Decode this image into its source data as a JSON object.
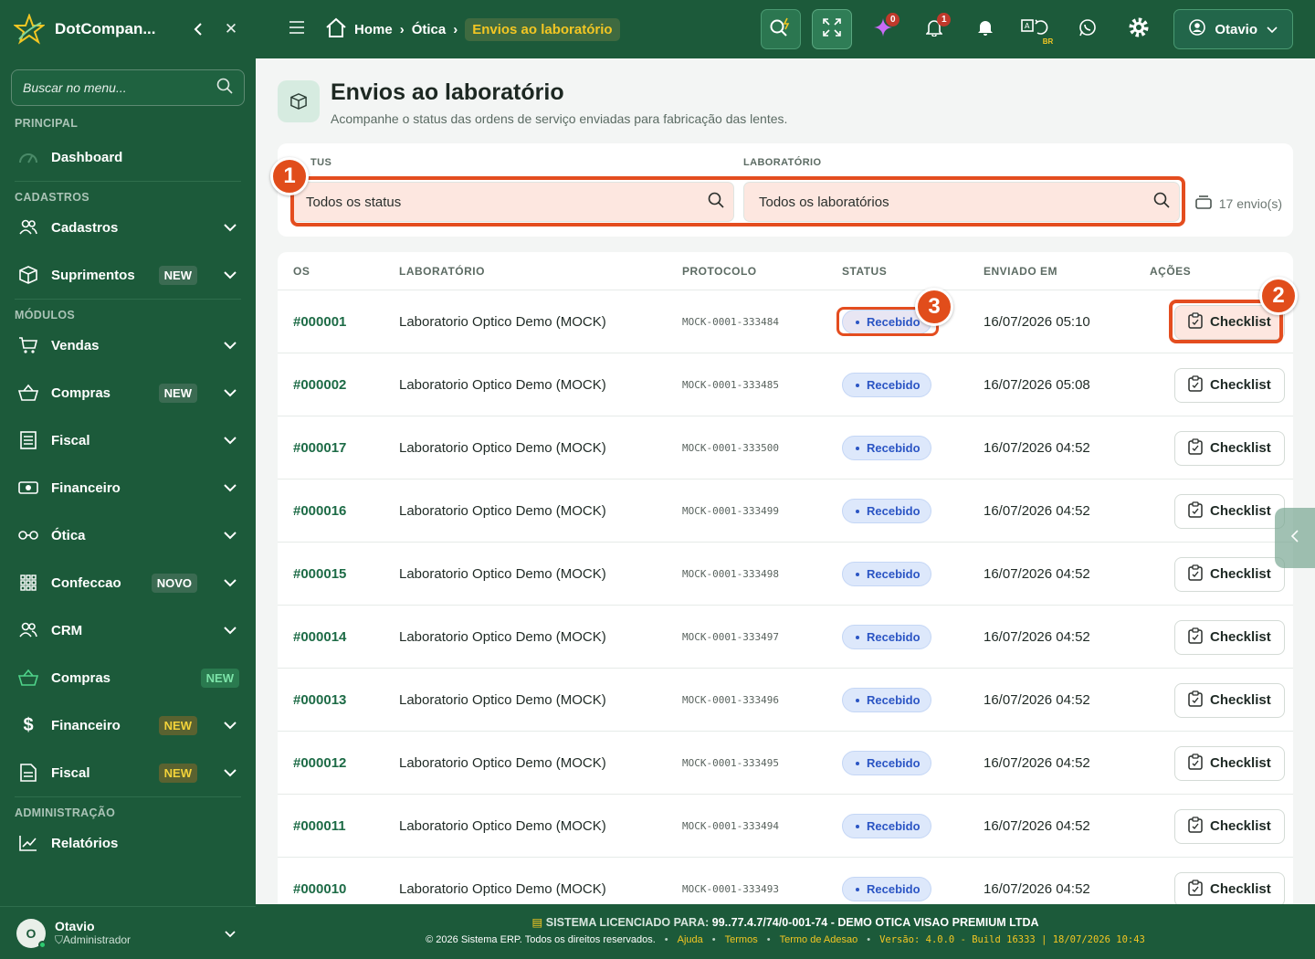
{
  "brand": {
    "name": "DotCompan..."
  },
  "sidebar": {
    "search_placeholder": "Buscar no menu...",
    "sections": {
      "principal": "PRINCIPAL",
      "cadastros": "CADASTROS",
      "modulos": "MÓDULOS",
      "administracao": "ADMINISTRAÇÃO"
    },
    "items": {
      "dashboard": "Dashboard",
      "cadastros": "Cadastros",
      "suprimentos": "Suprimentos",
      "vendas": "Vendas",
      "compras": "Compras",
      "fiscal": "Fiscal",
      "financeiro": "Financeiro",
      "otica": "Ótica",
      "confeccao": "Confeccao",
      "crm": "CRM",
      "compras2": "Compras",
      "financeiro2": "Financeiro",
      "fiscal2": "Fiscal",
      "relatorios": "Relatórios"
    },
    "badges": {
      "suprimentos": "NEW",
      "compras": "NEW",
      "confeccao": "NOVO",
      "compras2": "NEW",
      "financeiro2": "NEW",
      "fiscal2": "NEW"
    },
    "user": {
      "initial": "O",
      "name": "Otavio",
      "role": "Administrador"
    }
  },
  "topbar": {
    "breadcrumb": {
      "home": "Home",
      "otica": "Ótica",
      "current": "Envios ao laboratório"
    },
    "notif_sparkle": "0",
    "notif_bell": "1",
    "lang_label": "BR",
    "user": "Otavio"
  },
  "page": {
    "title": "Envios ao laboratório",
    "subtitle": "Acompanhe o status das ordens de serviço enviadas para fabricação das lentes."
  },
  "filters": {
    "status_label": "TUS",
    "status_value": "Todos os status",
    "lab_label": "LABORATÓRIO",
    "lab_value": "Todos os laboratórios",
    "count": "17 envio(s)"
  },
  "markers": {
    "m1": "1",
    "m2": "2",
    "m3": "3"
  },
  "table": {
    "headers": {
      "os": "OS",
      "lab": "LABORATÓRIO",
      "proto": "PROTOCOLO",
      "status": "STATUS",
      "sent": "ENVIADO EM",
      "actions": "AÇÕES"
    },
    "action_label": "Checklist",
    "rows": [
      {
        "os": "#000001",
        "lab": "Laboratorio Optico Demo (MOCK)",
        "proto": "MOCK-0001-333484",
        "status": "Recebido",
        "sent": "16/07/2026 05:10"
      },
      {
        "os": "#000002",
        "lab": "Laboratorio Optico Demo (MOCK)",
        "proto": "MOCK-0001-333485",
        "status": "Recebido",
        "sent": "16/07/2026 05:08"
      },
      {
        "os": "#000017",
        "lab": "Laboratorio Optico Demo (MOCK)",
        "proto": "MOCK-0001-333500",
        "status": "Recebido",
        "sent": "16/07/2026 04:52"
      },
      {
        "os": "#000016",
        "lab": "Laboratorio Optico Demo (MOCK)",
        "proto": "MOCK-0001-333499",
        "status": "Recebido",
        "sent": "16/07/2026 04:52"
      },
      {
        "os": "#000015",
        "lab": "Laboratorio Optico Demo (MOCK)",
        "proto": "MOCK-0001-333498",
        "status": "Recebido",
        "sent": "16/07/2026 04:52"
      },
      {
        "os": "#000014",
        "lab": "Laboratorio Optico Demo (MOCK)",
        "proto": "MOCK-0001-333497",
        "status": "Recebido",
        "sent": "16/07/2026 04:52"
      },
      {
        "os": "#000013",
        "lab": "Laboratorio Optico Demo (MOCK)",
        "proto": "MOCK-0001-333496",
        "status": "Recebido",
        "sent": "16/07/2026 04:52"
      },
      {
        "os": "#000012",
        "lab": "Laboratorio Optico Demo (MOCK)",
        "proto": "MOCK-0001-333495",
        "status": "Recebido",
        "sent": "16/07/2026 04:52"
      },
      {
        "os": "#000011",
        "lab": "Laboratorio Optico Demo (MOCK)",
        "proto": "MOCK-0001-333494",
        "status": "Recebido",
        "sent": "16/07/2026 04:52"
      },
      {
        "os": "#000010",
        "lab": "Laboratorio Optico Demo (MOCK)",
        "proto": "MOCK-0001-333493",
        "status": "Recebido",
        "sent": "16/07/2026 04:52"
      }
    ]
  },
  "footer": {
    "license_label": "SISTEMA LICENCIADO PARA:",
    "license_value": "99..77.4.7/74/0-001-74 - DEMO OTICA VISAO PREMIUM LTDA",
    "copyright": "© 2026 Sistema ERP. Todos os direitos reservados.",
    "links": {
      "help": "Ajuda",
      "terms": "Termos",
      "adesao": "Termo de Adesao"
    },
    "version": "Versão: 4.0.0 - Build 16333 | 18/07/2026 10:43"
  },
  "colors": {
    "primary": "#1c5a3a",
    "accent": "#f3c623",
    "highlight": "#e44d1f",
    "status_blue": "#2b55c4"
  }
}
